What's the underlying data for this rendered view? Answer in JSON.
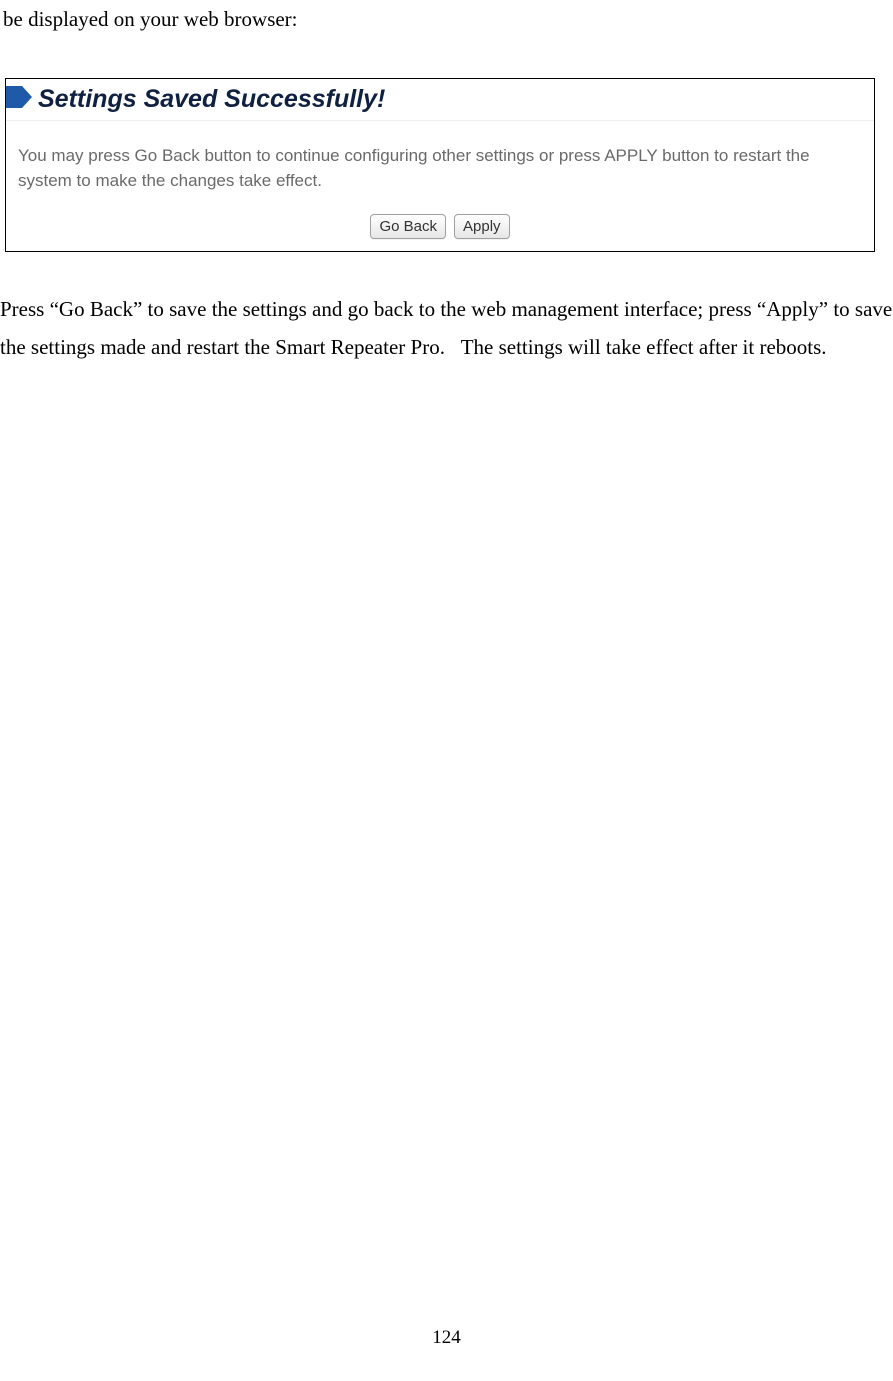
{
  "intro": "be displayed on your web browser:",
  "panel": {
    "title": "Settings Saved Successfully!",
    "message": "You may press Go Back button to continue configuring other settings or press APPLY button to restart the system to make the changes take effect.",
    "buttons": {
      "go_back": "Go Back",
      "apply": "Apply"
    }
  },
  "after": "Press “Go Back” to save the settings and go back to the web management interface; press “Apply” to save the settings made and restart the Smart Repeater Pro.   The settings will take effect after it reboots.",
  "page_number": "124"
}
